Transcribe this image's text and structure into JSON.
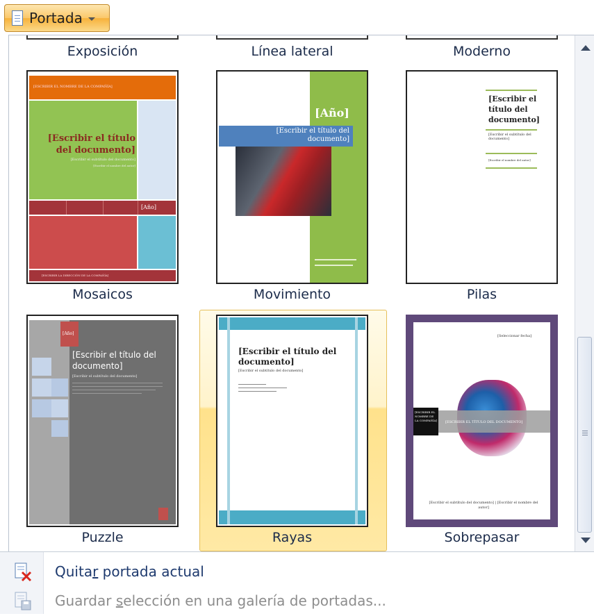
{
  "button": {
    "label": "Portada"
  },
  "gallery": {
    "top_row": [
      "Exposición",
      "Línea lateral",
      "Moderno"
    ],
    "items": [
      {
        "label": "Mosaicos",
        "texts": {
          "company": "[ESCRIBIR EL NOMBRE DE LA COMPAÑÍA]",
          "title": "[Escribir el título del documento]",
          "subtitle": "[Escribir el subtítulo del documento]",
          "date": "[Escribir el nombre del autor]",
          "year": "[Año]",
          "footer": "[ESCRIBIR LA DIRECCIÓN DE LA COMPAÑÍA]"
        }
      },
      {
        "label": "Movimiento",
        "texts": {
          "year": "[Año]",
          "title": "[Escribir el título del documento]"
        }
      },
      {
        "label": "Pilas",
        "texts": {
          "title": "[Escribir el título del documento]",
          "subtitle": "[Escribir el subtítulo del documento]",
          "author": "[Escribir el nombre del autor]"
        }
      },
      {
        "label": "Puzzle",
        "texts": {
          "year": "[Año]",
          "title": "[Escribir el título del documento]",
          "subtitle": "[Escribir el subtítulo del documento]"
        }
      },
      {
        "label": "Rayas",
        "texts": {
          "title": "[Escribir el título del documento]",
          "subtitle": "[Escribir el subtítulo del documento]"
        }
      },
      {
        "label": "Sobrepasar",
        "texts": {
          "date": "[Seleccionar fecha]",
          "company": "[ESCRIBIR EL NOMBRE DE LA COMPAÑÍA]",
          "title": "[ESCRIBIR EL TÍTULO DEL DOCUMENTO]",
          "subtitle": "[Escribir el subtítulo del documento] | [Escribir el nombre del autor]"
        }
      }
    ]
  },
  "menu": {
    "remove": {
      "pre": "Quita",
      "key": "r",
      "post": " portada actual"
    },
    "save": {
      "pre": "Guardar ",
      "key": "s",
      "post": "elección en una galería de portadas..."
    }
  },
  "colors": {
    "accent": "#f7b23b",
    "caption": "#1b2b4a",
    "disabled": "#8d8d8d"
  }
}
